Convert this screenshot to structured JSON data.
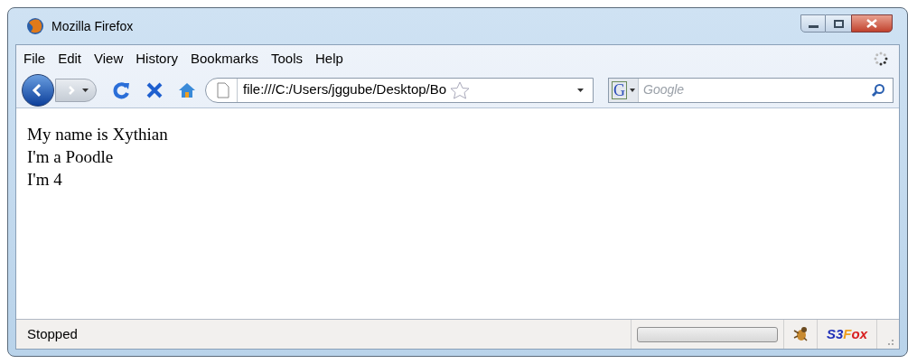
{
  "window": {
    "title": "Mozilla Firefox"
  },
  "menu": [
    "File",
    "Edit",
    "View",
    "History",
    "Bookmarks",
    "Tools",
    "Help"
  ],
  "address_bar": {
    "value": "file:///C:/Users/jggube/Desktop/Bo"
  },
  "search": {
    "placeholder": "Google",
    "engine": "G"
  },
  "content": {
    "lines": [
      "My name is Xythian",
      "I'm a Poodle",
      "I'm 4"
    ]
  },
  "status_bar": {
    "text": "Stopped",
    "progress": {
      "level": 0
    },
    "addon_logo": [
      {
        "text": "S3",
        "color": "#2030b8"
      },
      {
        "text": "F",
        "color": "#f0a020"
      },
      {
        "text": "ox",
        "color": "#d82020"
      }
    ]
  }
}
